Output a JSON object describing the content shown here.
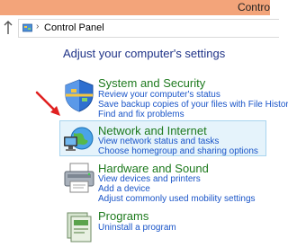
{
  "window": {
    "title": "Contro"
  },
  "address": {
    "crumb": "Control Panel",
    "separator": "›"
  },
  "heading": "Adjust your computer's settings",
  "categories": [
    {
      "title": "System and Security",
      "links": [
        "Review your computer's status",
        "Save backup copies of your files with File History",
        "Find and fix problems"
      ],
      "icon": "shield-icon"
    },
    {
      "title": "Network and Internet",
      "links": [
        "View network status and tasks",
        "Choose homegroup and sharing options"
      ],
      "icon": "network-icon",
      "highlighted": true
    },
    {
      "title": "Hardware and Sound",
      "links": [
        "View devices and printers",
        "Add a device",
        "Adjust commonly used mobility settings"
      ],
      "icon": "printer-icon"
    },
    {
      "title": "Programs",
      "links": [
        "Uninstall a program"
      ],
      "icon": "programs-icon"
    }
  ],
  "annotation": {
    "icon": "red-arrow-icon",
    "color": "#e02020"
  }
}
